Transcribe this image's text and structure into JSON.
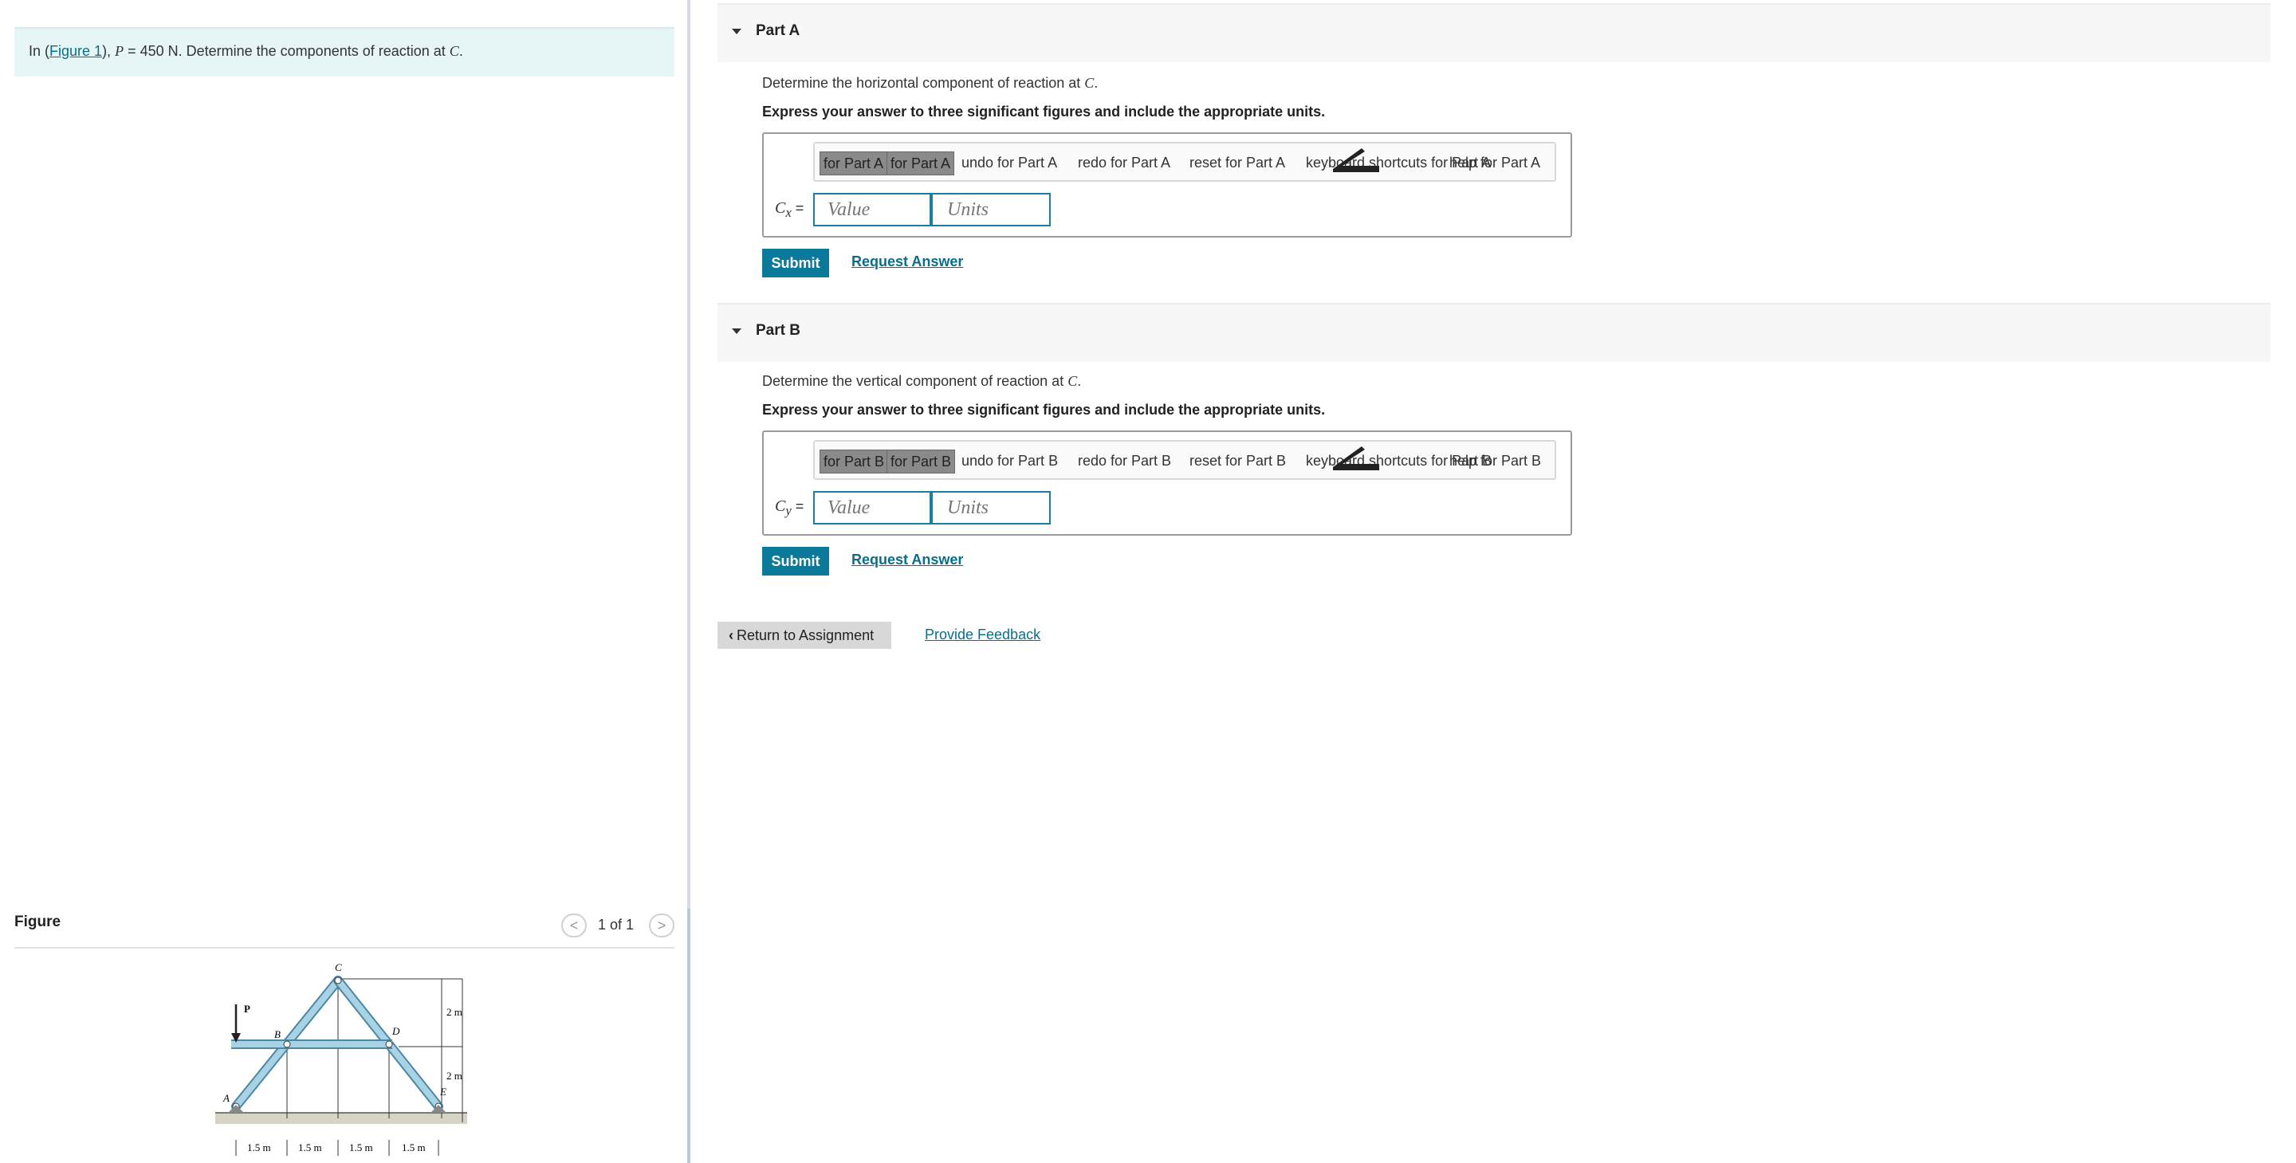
{
  "problem": {
    "prefix": "In (",
    "figure_link": "Figure 1",
    "suffix_1": "), ",
    "p_var": "P",
    "p_value": " = 450 N. Determine the components of reaction at ",
    "c_var": "C",
    "period": "."
  },
  "figure_panel": {
    "title": "Figure",
    "prev": "<",
    "count": "1 of 1",
    "next": ">",
    "labels": {
      "C": "C",
      "P": "P",
      "B": "B",
      "D": "D",
      "A": "A",
      "E": "E",
      "dim_top": "2 m",
      "dim_bottom": "2 m",
      "span1": "1.5 m",
      "span2": "1.5 m",
      "span3": "1.5 m",
      "span4": "1.5 m"
    }
  },
  "parts": [
    {
      "label": "Part A",
      "question_prefix": "Determine the horizontal component of reaction at ",
      "question_var": "C",
      "question_suffix": ".",
      "instruction": "Express your answer to three significant figures and include the appropriate units.",
      "toolbar": {
        "btn1": "for Part A",
        "btn2": "for Part A",
        "undo": "undo for Part A",
        "redo": "redo for Part A",
        "reset": "reset for Part A",
        "keyboard": "keyboard shortcuts for Part A",
        "help": "help for Part A"
      },
      "eq_var": "C",
      "eq_sub": "x",
      "eq_sign": " =",
      "value_placeholder": "Value",
      "units_placeholder": "Units",
      "submit": "Submit",
      "request": "Request Answer"
    },
    {
      "label": "Part B",
      "question_prefix": "Determine the vertical component of reaction at ",
      "question_var": "C",
      "question_suffix": ".",
      "instruction": "Express your answer to three significant figures and include the appropriate units.",
      "toolbar": {
        "btn1": "for Part B",
        "btn2": "for Part B",
        "undo": "undo for Part B",
        "redo": "redo for Part B",
        "reset": "reset for Part B",
        "keyboard": "keyboard shortcuts for Part B",
        "help": "help for Part B"
      },
      "eq_var": "C",
      "eq_sub": "y",
      "eq_sign": " =",
      "value_placeholder": "Value",
      "units_placeholder": "Units",
      "submit": "Submit",
      "request": "Request Answer"
    }
  ],
  "footer": {
    "return_label": "Return to Assignment",
    "feedback_label": "Provide Feedback"
  },
  "colors": {
    "accent": "#0b7a9a",
    "problem_bg": "#e6f5f6",
    "member_fill": "#a9d2e4"
  },
  "icons": {
    "caret": "caret-down-icon",
    "keyboard": "keyboard-icon",
    "return": "chevron-left-icon"
  }
}
